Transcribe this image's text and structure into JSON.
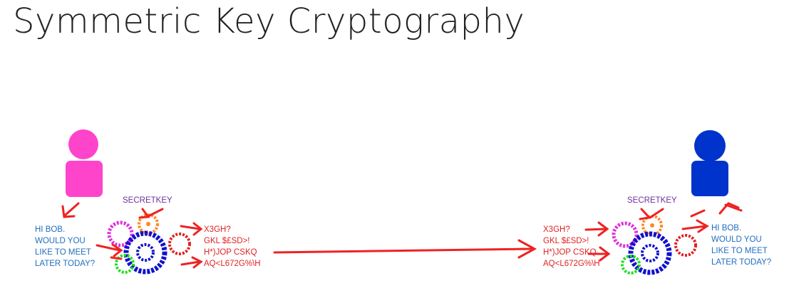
{
  "slide": {
    "title": "Symmetric Key Cryptography"
  },
  "sender": {
    "plaintext": [
      "HI BOB.",
      "WOULD YOU",
      "LIKE TO MEET",
      "LATER TODAY?"
    ],
    "key_label": "SECRETKEY",
    "ciphertext": [
      "X3GH?",
      "GKL $£SD>!",
      "H*)JOP CSKQ",
      "AQ<L672G%\\H"
    ],
    "person_color": "#ff44cc"
  },
  "receiver": {
    "ciphertext": [
      "X3GH?",
      "GKL $£SD>!",
      "H*)JOP CSKQ",
      "AQ<L672G%\\H"
    ],
    "key_label": "SECRETKEY",
    "plaintext": [
      "HI BOB.",
      "WOULD YOU",
      "LIKE TO MEET",
      "LATER TODAY?"
    ],
    "person_color": "#0033cc"
  },
  "colors": {
    "arrow": "#ee2222",
    "text_plain": "#1f6fc0",
    "text_cipher": "#e02222",
    "key": "#7030a0"
  }
}
